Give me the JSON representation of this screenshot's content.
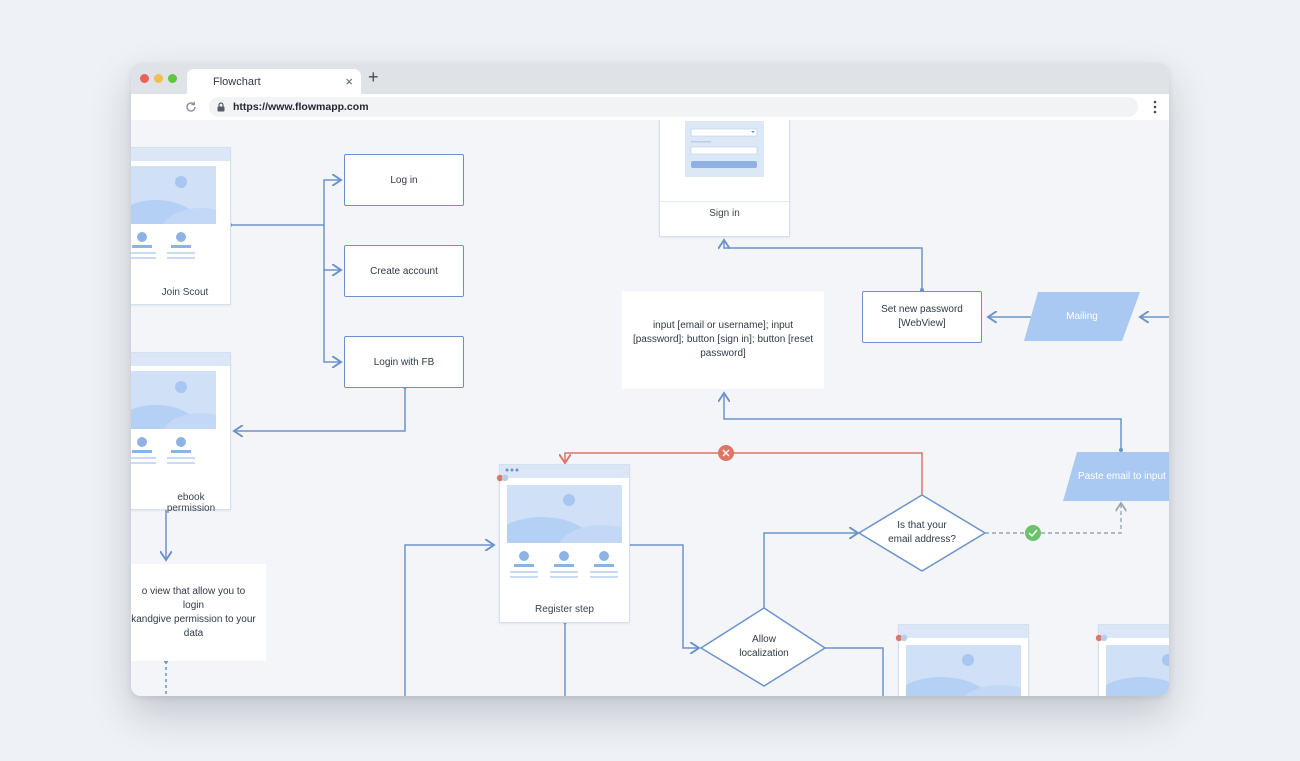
{
  "browser": {
    "tab_title": "Flowchart",
    "close_glyph": "×",
    "new_tab_glyph": "+",
    "url": "https://www.flowmapp.com",
    "icons": [
      "reload-icon",
      "lock-icon",
      "menu-dots-icon",
      "close-icon",
      "plus-icon"
    ]
  },
  "flow": {
    "screens": {
      "join_scout": "Join Scout",
      "facebook_permission": "ebook permission",
      "sign_in": "Sign in",
      "register_step": "Register step"
    },
    "actions": {
      "log_in": "Log in",
      "create_account": "Create account",
      "login_fb": "Login with FB",
      "set_password_line1": "Set new password",
      "set_password_line2": "[WebView]"
    },
    "notes": {
      "fb_view_line1": "o view that allow you to login",
      "fb_view_line2": "kandgive permission to your",
      "fb_view_line3": "data",
      "signin_inputs_line1": "input [email or username]; input",
      "signin_inputs_line2": "[password]; button [sign in]; button [reset",
      "signin_inputs_line3": "password]"
    },
    "io": {
      "mailing": "Mailing",
      "paste_email": "Paste email to input"
    },
    "decisions": {
      "email_line1": "Is that your",
      "email_line2": "email address?",
      "localization_line1": "Allow",
      "localization_line2": "localization"
    },
    "colors": {
      "connector": "#6c93c9",
      "reject": "#e07468",
      "accept": "#6cc26a",
      "io_fill": "#a9c8f2"
    }
  }
}
